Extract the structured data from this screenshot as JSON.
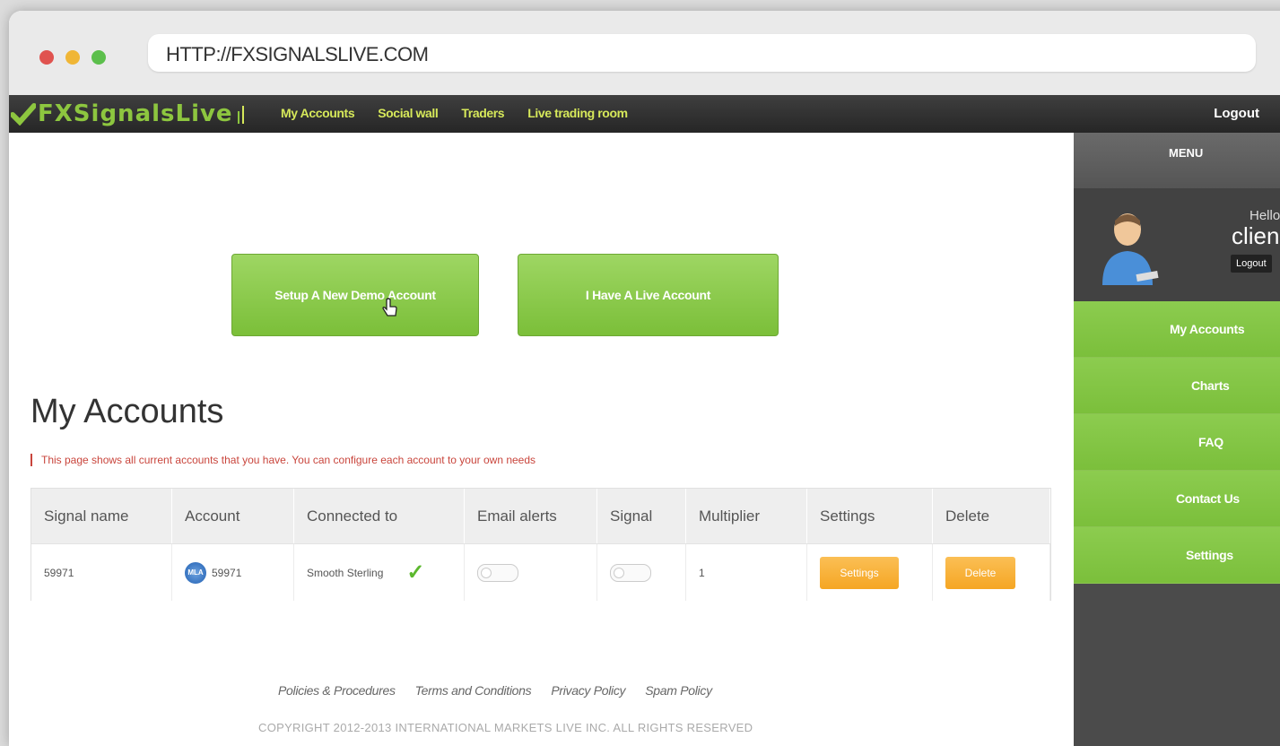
{
  "browser": {
    "url": "HTTP://FXSIGNALSLIVE.COM"
  },
  "nav": {
    "logo_text": "FXSignalsLive",
    "links": [
      "My Accounts",
      "Social wall",
      "Traders",
      "Live trading room"
    ],
    "logout": "Logout"
  },
  "actions": {
    "demo_button": "Setup A New Demo Account",
    "live_button": "I Have A Live Account"
  },
  "page": {
    "title": "My Accounts",
    "description": "This page shows all current accounts that you have. You can configure each account to your own needs"
  },
  "table": {
    "headers": [
      "Signal name",
      "Account",
      "Connected to",
      "Email alerts",
      "Signal",
      "Multiplier",
      "Settings",
      "Delete"
    ],
    "rows": [
      {
        "signal_name": "59971",
        "account_badge": "MLA",
        "account": "59971",
        "connected_to": "Smooth Sterling",
        "email_alerts": false,
        "signal": false,
        "multiplier": "1",
        "settings_label": "Settings",
        "delete_label": "Delete"
      }
    ]
  },
  "footer": {
    "links": [
      "Policies & Procedures",
      "Terms and Conditions",
      "Privacy Policy",
      "Spam Policy"
    ],
    "copyright": "COPYRIGHT 2012-2013 INTERNATIONAL MARKETS LIVE INC. ALL RIGHTS RESERVED"
  },
  "sidebar": {
    "menu_header": "MENU",
    "hello": "Hello",
    "username": "clien",
    "logout": "Logout",
    "items": [
      "My Accounts",
      "Charts",
      "FAQ",
      "Contact Us",
      "Settings"
    ]
  },
  "colors": {
    "accent_green": "#8dc63f",
    "nav_link": "#d6e85a",
    "orange": "#f5a623",
    "note_red": "#c9453c"
  }
}
